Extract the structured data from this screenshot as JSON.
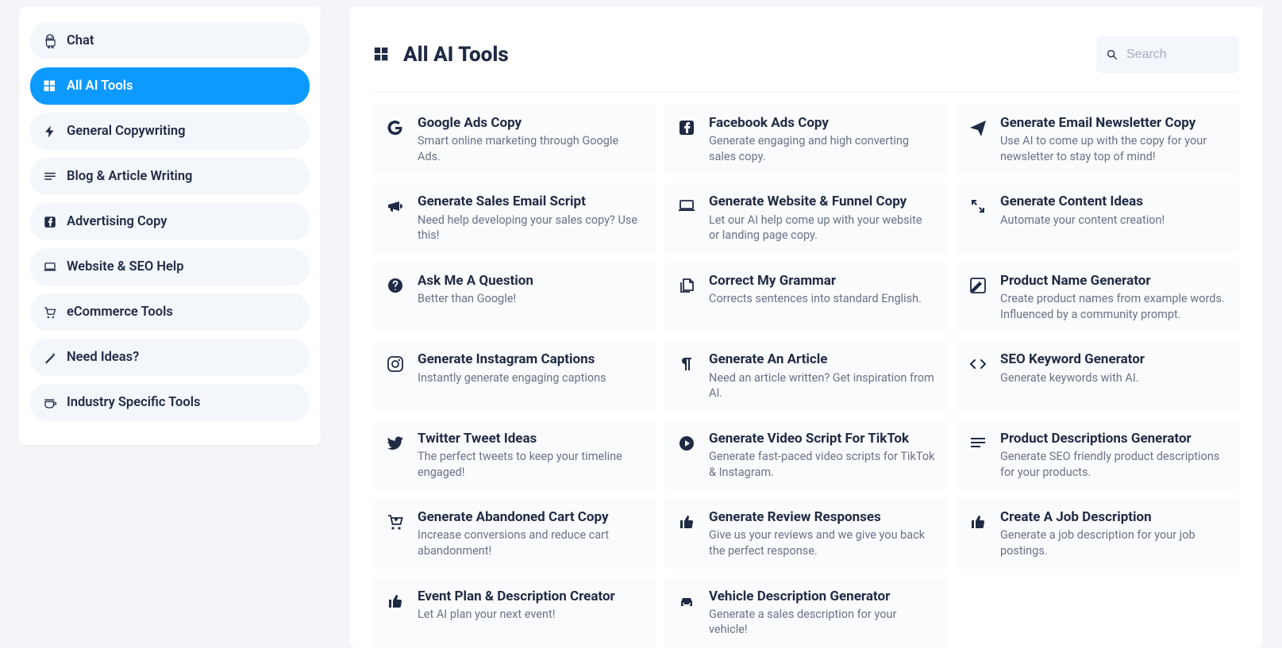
{
  "sidebar": {
    "items": [
      {
        "label": "Chat",
        "icon": "android"
      },
      {
        "label": "All AI Tools",
        "icon": "grid",
        "active": true
      },
      {
        "label": "General Copywriting",
        "icon": "bolt"
      },
      {
        "label": "Blog & Article Writing",
        "icon": "lines"
      },
      {
        "label": "Advertising Copy",
        "icon": "facebook"
      },
      {
        "label": "Website & SEO Help",
        "icon": "laptop"
      },
      {
        "label": "eCommerce Tools",
        "icon": "cart"
      },
      {
        "label": "Need Ideas?",
        "icon": "wand"
      },
      {
        "label": "Industry Specific Tools",
        "icon": "coffee"
      }
    ]
  },
  "header": {
    "title": "All AI Tools",
    "search_placeholder": "Search"
  },
  "tools": [
    {
      "icon": "google",
      "title": "Google Ads Copy",
      "desc": "Smart online marketing through Google Ads."
    },
    {
      "icon": "facebook",
      "title": "Facebook Ads Copy",
      "desc": "Generate engaging and high converting sales copy."
    },
    {
      "icon": "send",
      "title": "Generate Email Newsletter Copy",
      "desc": "Use AI to come up with the copy for your newsletter to stay top of mind!"
    },
    {
      "icon": "bullhorn",
      "title": "Generate Sales Email Script",
      "desc": "Need help developing your sales copy? Use this!"
    },
    {
      "icon": "laptop",
      "title": "Generate Website & Funnel Copy",
      "desc": "Let our AI help come up with your website or landing page copy."
    },
    {
      "icon": "expand",
      "title": "Generate Content Ideas",
      "desc": "Automate your content creation!"
    },
    {
      "icon": "question",
      "title": "Ask Me A Question",
      "desc": "Better than Google!"
    },
    {
      "icon": "filecopy",
      "title": "Correct My Grammar",
      "desc": "Corrects sentences into standard English."
    },
    {
      "icon": "edit",
      "title": "Product Name Generator",
      "desc": "Create product names from example words. Influenced by a community prompt."
    },
    {
      "icon": "instagram",
      "title": "Generate Instagram Captions",
      "desc": "Instantly generate engaging captions"
    },
    {
      "icon": "paragraph",
      "title": "Generate An Article",
      "desc": "Need an article written? Get inspiration from AI."
    },
    {
      "icon": "code",
      "title": "SEO Keyword Generator",
      "desc": "Generate keywords with AI."
    },
    {
      "icon": "twitter",
      "title": "Twitter Tweet Ideas",
      "desc": "The perfect tweets to keep your timeline engaged!"
    },
    {
      "icon": "play",
      "title": "Generate Video Script For TikTok",
      "desc": "Generate fast-paced video scripts for TikTok & Instagram."
    },
    {
      "icon": "lines",
      "title": "Product Descriptions Generator",
      "desc": "Generate SEO friendly product descriptions for your products."
    },
    {
      "icon": "cartplus",
      "title": "Generate Abandoned Cart Copy",
      "desc": "Increase conversions and reduce cart abandonment!"
    },
    {
      "icon": "thumb",
      "title": "Generate Review Responses",
      "desc": "Give us your reviews and we give you back the perfect response."
    },
    {
      "icon": "thumb",
      "title": "Create A Job Description",
      "desc": "Generate a job description for your job postings."
    },
    {
      "icon": "thumb",
      "title": "Event Plan & Description Creator",
      "desc": "Let AI plan your next event!"
    },
    {
      "icon": "car",
      "title": "Vehicle Description Generator",
      "desc": "Generate a sales description for your vehicle!"
    }
  ]
}
